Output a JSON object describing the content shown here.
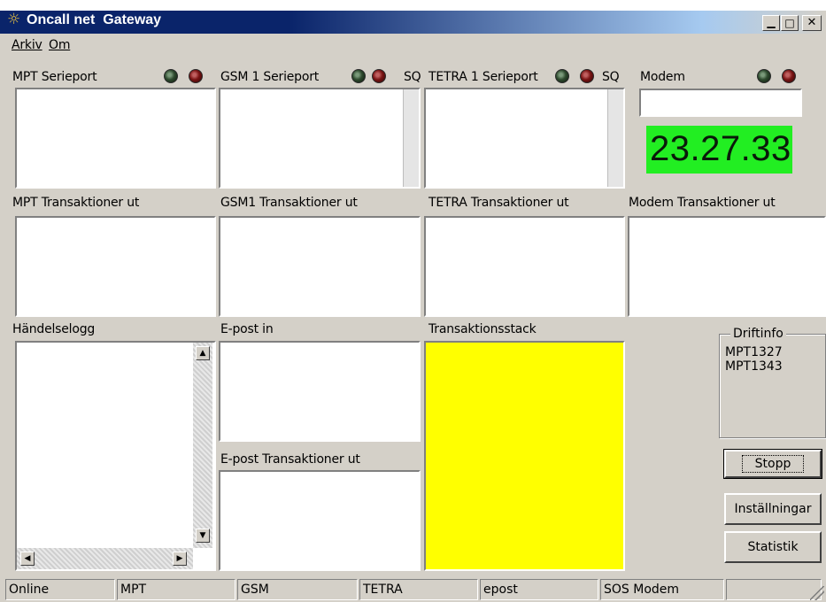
{
  "window": {
    "title": "Oncall net  Gateway"
  },
  "menu": {
    "items": [
      "Arkiv",
      "Om"
    ]
  },
  "panels": {
    "mpt_serial": "MPT Serieport",
    "gsm_serial": "GSM 1 Serieport",
    "gsm_sq": "SQ",
    "tetra_serial": "TETRA 1 Serieport",
    "tetra_sq": "SQ",
    "modem": "Modem",
    "clock": "23.27.33",
    "mpt_tx": "MPT Transaktioner ut",
    "gsm_tx": "GSM1 Transaktioner ut",
    "tetra_tx": "TETRA Transaktioner ut",
    "modem_tx": "Modem Transaktioner ut",
    "eventlog": "Händelselogg",
    "email_in": "E-post in",
    "email_tx": "E-post Transaktioner ut",
    "tx_stack": "Transaktionsstack"
  },
  "driftinfo": {
    "title": "Driftinfo",
    "lines": [
      "MPT1327",
      "MPT1343"
    ]
  },
  "buttons": {
    "stop": "Stopp",
    "settings": "Inställningar",
    "stats": "Statistik"
  },
  "statusbar": [
    "Online",
    "MPT",
    "GSM",
    "TETRA",
    "epost",
    "SOS Modem",
    ""
  ],
  "colors": {
    "clock_bg": "#22ee22",
    "stack_bg": "#ffff00",
    "titlebar_start": "#0a246a",
    "titlebar_end": "#a6caf0"
  }
}
